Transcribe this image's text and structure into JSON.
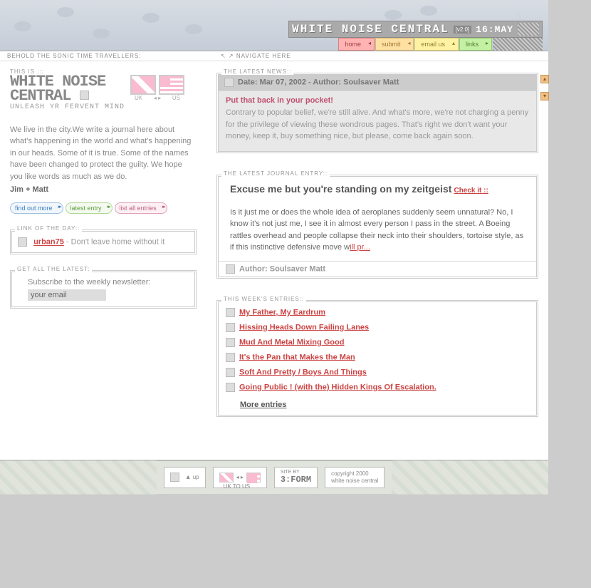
{
  "header": {
    "title": "WHITE NOISE CENTRAL",
    "version": "[v2.0]",
    "date": "16:MAY",
    "nav": [
      "home",
      "submit",
      "email us",
      "links"
    ]
  },
  "subhead": {
    "left": "BEHOLD THE SONIC TIME TRAVELLERS:",
    "right": "↖ ↗ NAVIGATE HERE"
  },
  "logo": {
    "this_is": "THIS IS :::",
    "line1": "WHITE NOISE",
    "line2": "CENTRAL",
    "tagline": "UNLEASH YR FERVENT MIND",
    "uk": "UK",
    "us": "US",
    "arrow": "◂ ▸"
  },
  "intro": "We live in the city.We write a journal here about what's happening in the world and what's happening in our heads. Some of it is true. Some of the names have been changed to protect the guilty. We hope you like words as much as we do.",
  "sig": "Jim + Matt",
  "pills": {
    "find": "find out more",
    "latest": "latest entry",
    "list": "list all entries"
  },
  "linkday": {
    "label": "LINK OF THE DAY::",
    "name": "urban75",
    "desc": " - Don't leave home without it"
  },
  "newsletter": {
    "label": "GET ALL THE LATEST:",
    "text": "Subscribe to the weekly newsletter:",
    "placeholder": "your email"
  },
  "news": {
    "label": "THE LATEST NEWS::",
    "meta": "Date: Mar 07, 2002 - Author: Soulsaver Matt",
    "title": "Put that back in your pocket!",
    "body": "Contrary to popular belief, we're still alive. And what's more, we're not charging a penny for the privilege of viewing these wondrous pages. That's right we don't want your money, keep it, buy something nice, but please, come back again soon."
  },
  "journal": {
    "label": "THE LATEST JOURNAL ENTRY::",
    "title": "Excuse me but you're standing on my zeitgeist",
    "check": "Check it ::",
    "body": "Is it just me or does the whole idea of aeroplanes suddenly seem unnatural? No, I know it's not just me, I see it in almost every person I pass in the street. A Boeing rattles overhead and people collapse their neck into their shoulders, tortoise style, as if this instinctive defensive move w",
    "more": "ill pr...",
    "author": "Author: Soulsaver Matt"
  },
  "week": {
    "label": "THIS WEEK'S ENTRIES::",
    "entries": [
      "My Father, My Eardrum",
      "Hissing Heads Down Failing Lanes",
      "Mud And Metal Mixing Good",
      "It's the Pan that Makes the Man",
      "Soft And Pretty / Boys And Things",
      "Going Public ! (with the) Hidden Kings Of Escalation."
    ],
    "more": "More entries"
  },
  "footer": {
    "up": "up",
    "uktous": "UK TO US",
    "siteby_label": "SITE BY",
    "siteby": "3:FORM",
    "copyright": "copyright 2000\nwhite noise central"
  }
}
